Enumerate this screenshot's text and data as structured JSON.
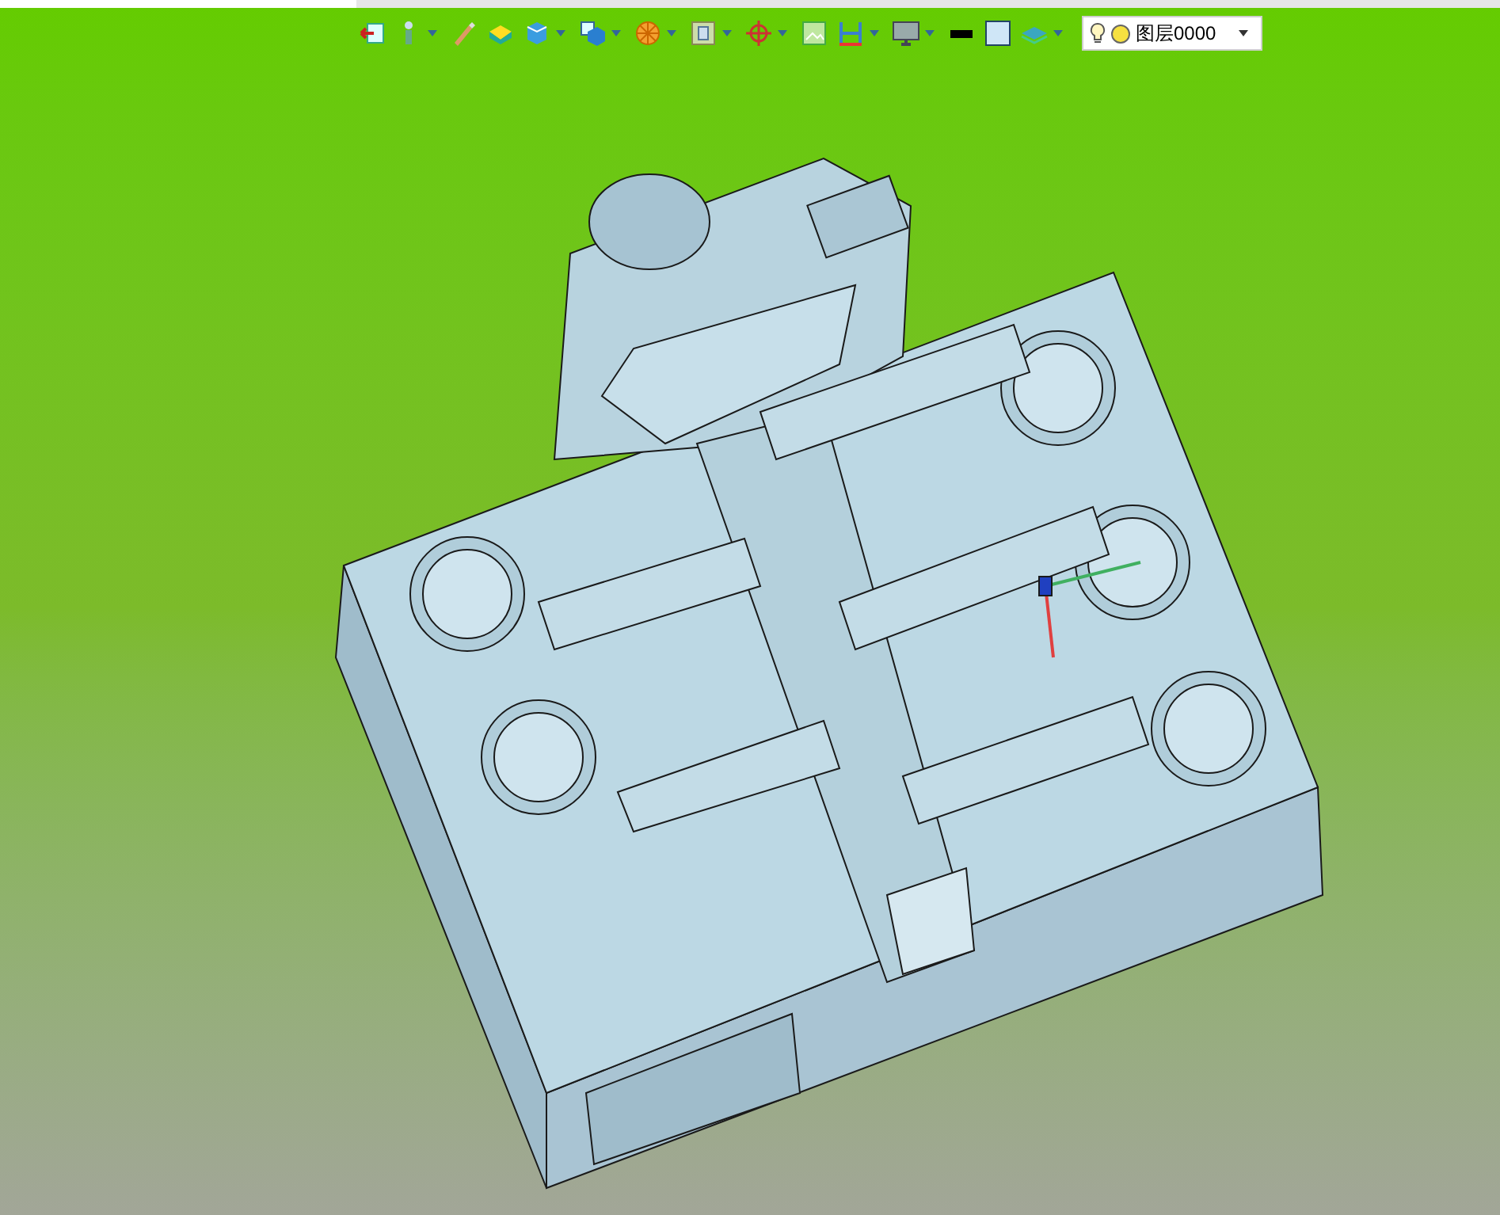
{
  "toolbar": {
    "layer_select": {
      "value": "图层0000"
    }
  }
}
